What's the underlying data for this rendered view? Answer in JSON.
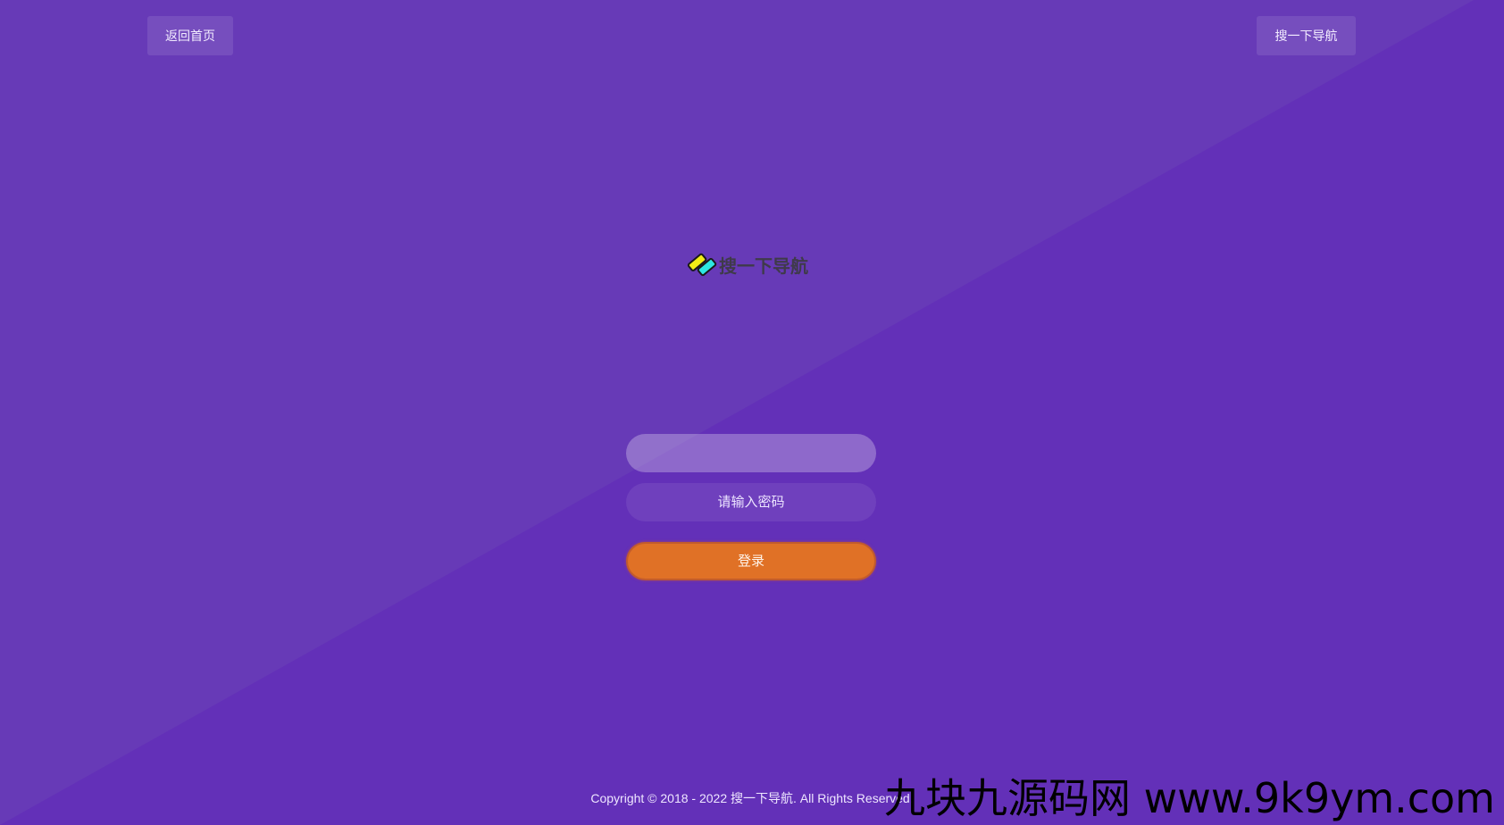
{
  "colors": {
    "background": "#6330b8",
    "background_light": "#673ab7",
    "login_button": "#e07126",
    "logo_yellow": "#f2ec16",
    "logo_cyan": "#2ee6e2"
  },
  "topbar": {
    "home_label": "返回首页",
    "brand_label": "搜一下导航"
  },
  "logo": {
    "icon": "lightning-logo-icon",
    "text": "搜一下导航"
  },
  "form": {
    "username_value": "",
    "username_placeholder": "",
    "password_placeholder": "请输入密码",
    "login_label": "登录"
  },
  "footer": {
    "copyright": "Copyright © 2018 - 2022 搜一下导航. All Rights Reserved."
  },
  "watermark": {
    "text": "九块九源码网 www.9k9ym.com"
  }
}
